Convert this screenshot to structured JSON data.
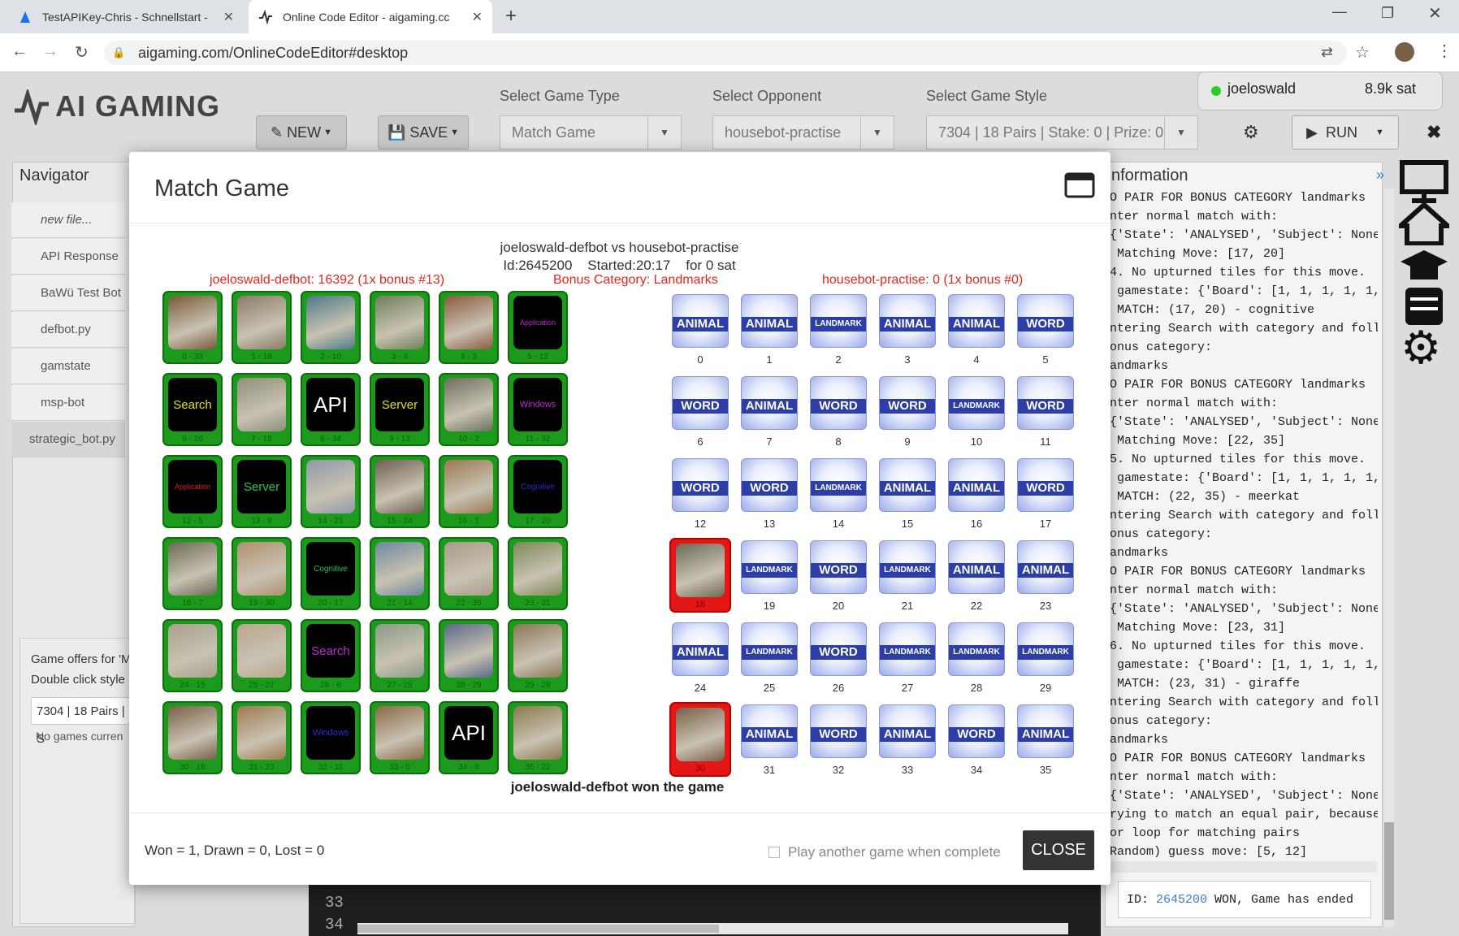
{
  "browser": {
    "tabs": [
      {
        "title": "TestAPIKey-Chris - Schnellstart - ",
        "active": false
      },
      {
        "title": "Online Code Editor - aigaming.cc",
        "active": true
      }
    ],
    "new_tab": "+",
    "url": "aigaming.com/OnlineCodeEditor#desktop"
  },
  "app": {
    "logo": "AI GAMING",
    "new_label": "NEW",
    "save_label": "SAVE",
    "game_type_label": "Select Game Type",
    "game_type_value": "Match Game",
    "opponent_label": "Select Opponent",
    "opponent_value": "housebot-practise",
    "style_label": "Select Game Style",
    "style_value": "7304 | 18 Pairs | Stake: 0 | Prize: 0",
    "run_label": "RUN",
    "user": "joeloswald",
    "balance": "8.9k sat"
  },
  "navigator": {
    "title": "Navigator",
    "items": [
      "new file...",
      "API Response",
      "BaWü Test Bot",
      "defbot.py",
      "gamstate",
      "msp-bot",
      "strategic_bot.py"
    ],
    "offers": "Game offers for 'M",
    "hint": "Double click style",
    "style_row": "7304 | 18 Pairs | S",
    "no_games": "No games curren"
  },
  "info": {
    "title": "nformation",
    "log": [
      "O PAIR FOR BONUS CATEGORY landmarks",
      "nter normal match with:",
      "{'State': 'ANALYSED', 'Subject': None",
      " Matching Move: [17, 20]",
      "4. No upturned tiles for this move.",
      " gamestate: {'Board': [1, 1, 1, 1, 1,",
      " MATCH: (17, 20) - cognitive",
      "ntering Search with category and foll",
      "onus category:",
      "andmarks",
      "O PAIR FOR BONUS CATEGORY landmarks",
      "nter normal match with:",
      "{'State': 'ANALYSED', 'Subject': None",
      " Matching Move: [22, 35]",
      "5. No upturned tiles for this move.",
      " gamestate: {'Board': [1, 1, 1, 1, 1,",
      " MATCH: (22, 35) - meerkat",
      "ntering Search with category and foll",
      "onus category:",
      "andmarks",
      "O PAIR FOR BONUS CATEGORY landmarks",
      "nter normal match with:",
      "{'State': 'ANALYSED', 'Subject': None",
      " Matching Move: [23, 31]",
      "6. No upturned tiles for this move.",
      " gamestate: {'Board': [1, 1, 1, 1, 1,",
      " MATCH: (23, 31) - giraffe",
      "ntering Search with category and foll",
      "onus category:",
      "andmarks",
      "O PAIR FOR BONUS CATEGORY landmarks",
      "nter normal match with:",
      "{'State': 'ANALYSED', 'Subject': None",
      "rying to match an equal pair, because",
      "or loop for matching pairs",
      "Random) guess move: [5, 12]"
    ],
    "status_id": "2645200",
    "status_text": " WON, Game has ended",
    "status_prefix": "ID: "
  },
  "editor": {
    "line1": "33",
    "line2": "34"
  },
  "modal": {
    "title": "Match Game",
    "matchup": "joeloswald-defbot vs housebot-practise",
    "meta": "Id:2645200    Started:20:17    for 0 sat",
    "left_score": "joeloswald-defbot: 16392 (1x bonus #13)",
    "bonus": "Bonus Category: Landmarks",
    "right_score": "housebot-practise: 0 (1x bonus #0)",
    "result": "joeloswald-defbot won the game",
    "record": "Won = 1, Drawn = 0, Lost = 0",
    "play_again": "Play another game when complete",
    "close": "CLOSE",
    "left_tiles": [
      {
        "label": "0 - 33",
        "kind": "img",
        "c": "#7a5a3a"
      },
      {
        "label": "1 - 16",
        "kind": "img",
        "c": "#8a7b68"
      },
      {
        "label": "2 - 10",
        "kind": "img",
        "c": "#4d7a86"
      },
      {
        "label": "3 - 4",
        "kind": "img",
        "c": "#6f7f5a"
      },
      {
        "label": "4 - 3",
        "kind": "img",
        "c": "#8b5b3f"
      },
      {
        "label": "5 - 12",
        "kind": "text",
        "text": "Application",
        "color": "#c026d3",
        "size": 9
      },
      {
        "label": "6 - 26",
        "kind": "text",
        "text": "Search",
        "color": "#e5e000",
        "size": 15
      },
      {
        "label": "7 - 18",
        "kind": "img",
        "c": "#8d8f7a"
      },
      {
        "label": "8 - 34",
        "kind": "text",
        "text": "API",
        "color": "#ffffff",
        "size": 26
      },
      {
        "label": "9 - 13",
        "kind": "text",
        "text": "Server",
        "color": "#e5e000",
        "size": 15
      },
      {
        "label": "10 - 2",
        "kind": "img",
        "c": "#6b6f5c"
      },
      {
        "label": "11 - 32",
        "kind": "text",
        "text": "Windows",
        "color": "#c026d3",
        "size": 11
      },
      {
        "label": "12 - 5",
        "kind": "text",
        "text": "Application",
        "color": "#e02020",
        "size": 9
      },
      {
        "label": "13 - 9",
        "kind": "text",
        "text": "Server",
        "color": "#22c55e",
        "size": 15
      },
      {
        "label": "14 - 21",
        "kind": "img",
        "c": "#8f98a8"
      },
      {
        "label": "15 - 24",
        "kind": "img",
        "c": "#6f5f52"
      },
      {
        "label": "16 - 1",
        "kind": "img",
        "c": "#9a7a55"
      },
      {
        "label": "17 - 20",
        "kind": "text",
        "text": "Cognitive",
        "color": "#2a2ad0",
        "size": 10
      },
      {
        "label": "18 - 7",
        "kind": "img",
        "c": "#6b6a55"
      },
      {
        "label": "19 - 30",
        "kind": "img",
        "c": "#b09070"
      },
      {
        "label": "20 - 17",
        "kind": "text",
        "text": "Cognitive",
        "color": "#22c55e",
        "size": 10
      },
      {
        "label": "21 - 14",
        "kind": "img",
        "c": "#6d88a0"
      },
      {
        "label": "22 - 35",
        "kind": "img",
        "c": "#a99a88"
      },
      {
        "label": "23 - 31",
        "kind": "img",
        "c": "#7d8a5a"
      },
      {
        "label": "24 - 15",
        "kind": "img",
        "c": "#a9a08c"
      },
      {
        "label": "25 - 27",
        "kind": "img",
        "c": "#b9a78c"
      },
      {
        "label": "26 - 6",
        "kind": "text",
        "text": "Search",
        "color": "#c026d3",
        "size": 15
      },
      {
        "label": "27 - 25",
        "kind": "img",
        "c": "#8a9a88"
      },
      {
        "label": "28 - 29",
        "kind": "img",
        "c": "#5a6a88"
      },
      {
        "label": "29 - 28",
        "kind": "img",
        "c": "#8a7858"
      },
      {
        "label": "30 - 19",
        "kind": "img",
        "c": "#7a6048"
      },
      {
        "label": "31 - 23",
        "kind": "img",
        "c": "#a07a50"
      },
      {
        "label": "32 - 11",
        "kind": "text",
        "text": "Windows",
        "color": "#2a2ad0",
        "size": 11
      },
      {
        "label": "33 - 0",
        "kind": "img",
        "c": "#8a6a48"
      },
      {
        "label": "34 - 8",
        "kind": "text",
        "text": "API",
        "color": "#ffffff",
        "size": 26
      },
      {
        "label": "35 - 22",
        "kind": "img",
        "c": "#8a7a50"
      }
    ],
    "right_tiles": [
      "ANIMAL",
      "ANIMAL",
      "LANDMARK",
      "ANIMAL",
      "ANIMAL",
      "WORD",
      "WORD",
      "ANIMAL",
      "WORD",
      "WORD",
      "LANDMARK",
      "WORD",
      "WORD",
      "WORD",
      "LANDMARK",
      "ANIMAL",
      "ANIMAL",
      "WORD",
      "#18",
      "LANDMARK",
      "WORD",
      "LANDMARK",
      "ANIMAL",
      "ANIMAL",
      "ANIMAL",
      "LANDMARK",
      "WORD",
      "LANDMARK",
      "LANDMARK",
      "LANDMARK",
      "#30",
      "ANIMAL",
      "WORD",
      "ANIMAL",
      "WORD",
      "ANIMAL"
    ],
    "right_red": {
      "18": {
        "label": "18",
        "c": "#6b6a55"
      },
      "30": {
        "label": "30",
        "c": "#7a6048"
      }
    }
  }
}
